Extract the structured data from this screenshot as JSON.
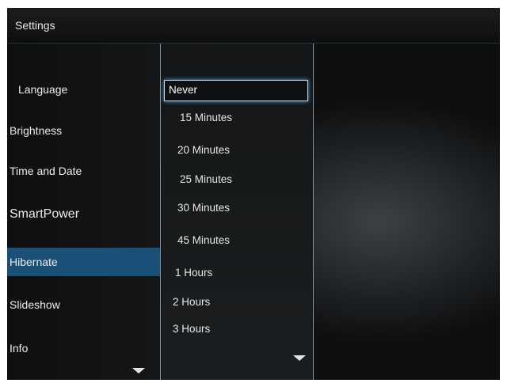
{
  "window": {
    "title": "Settings"
  },
  "menu": {
    "items": [
      {
        "label": "Language"
      },
      {
        "label": "Brightness"
      },
      {
        "label": "Time and Date"
      },
      {
        "label": "SmartPower"
      },
      {
        "label": "Hibernate",
        "selected": true
      },
      {
        "label": "Slideshow"
      },
      {
        "label": "Info"
      }
    ]
  },
  "options": {
    "selected": "Never",
    "items": [
      {
        "label": "Never"
      },
      {
        "label": "15 Minutes"
      },
      {
        "label": "20 Minutes"
      },
      {
        "label": "25 Minutes"
      },
      {
        "label": "30 Minutes"
      },
      {
        "label": "45 Minutes"
      },
      {
        "label": "1 Hours"
      },
      {
        "label": "2 Hours"
      },
      {
        "label": "3 Hours"
      }
    ]
  },
  "colors": {
    "selected_item_bg": "#1a4f77",
    "focus_border": "#c0d6e6"
  },
  "icons": {
    "menu_scroll": "triangle-down-icon",
    "options_scroll": "triangle-down-icon"
  }
}
